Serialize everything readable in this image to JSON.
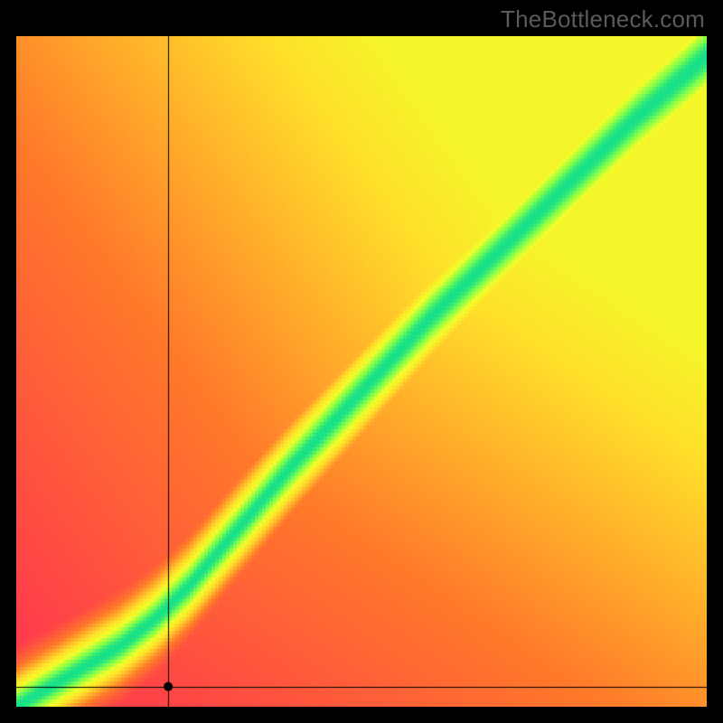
{
  "watermark": "TheBottleneck.com",
  "colors": {
    "background": "#000000",
    "crosshair": "#000000",
    "marker": "#000000"
  },
  "chart_data": {
    "type": "heatmap",
    "title": "",
    "xlabel": "",
    "ylabel": "",
    "xlim": [
      0,
      100
    ],
    "ylim": [
      0,
      100
    ],
    "grid": false,
    "legend": false,
    "description": "Bottleneck heatmap. Green diagonal band indicates balanced pairing; values fade through yellow/orange to red away from the band. Slight ease-in curve near the origin.",
    "color_scale": [
      {
        "at": 0.0,
        "color": "#ff2a55"
      },
      {
        "at": 0.4,
        "color": "#ff7a2a"
      },
      {
        "at": 0.68,
        "color": "#ffe02a"
      },
      {
        "at": 0.82,
        "color": "#f2ff2a"
      },
      {
        "at": 0.93,
        "color": "#7dff4d"
      },
      {
        "at": 1.0,
        "color": "#16e08a"
      }
    ],
    "optimal_curve_samples": [
      {
        "x": 0,
        "y": 0
      },
      {
        "x": 5,
        "y": 3
      },
      {
        "x": 10,
        "y": 6
      },
      {
        "x": 15,
        "y": 9
      },
      {
        "x": 20,
        "y": 13
      },
      {
        "x": 25,
        "y": 18
      },
      {
        "x": 30,
        "y": 24
      },
      {
        "x": 40,
        "y": 36
      },
      {
        "x": 50,
        "y": 47
      },
      {
        "x": 60,
        "y": 58
      },
      {
        "x": 70,
        "y": 68
      },
      {
        "x": 80,
        "y": 78
      },
      {
        "x": 90,
        "y": 88
      },
      {
        "x": 100,
        "y": 97
      }
    ],
    "green_band_halfwidth_pct": 5.0,
    "crosshair": {
      "x": 22.0,
      "y": 3.0
    },
    "marker_radius_px": 5
  }
}
